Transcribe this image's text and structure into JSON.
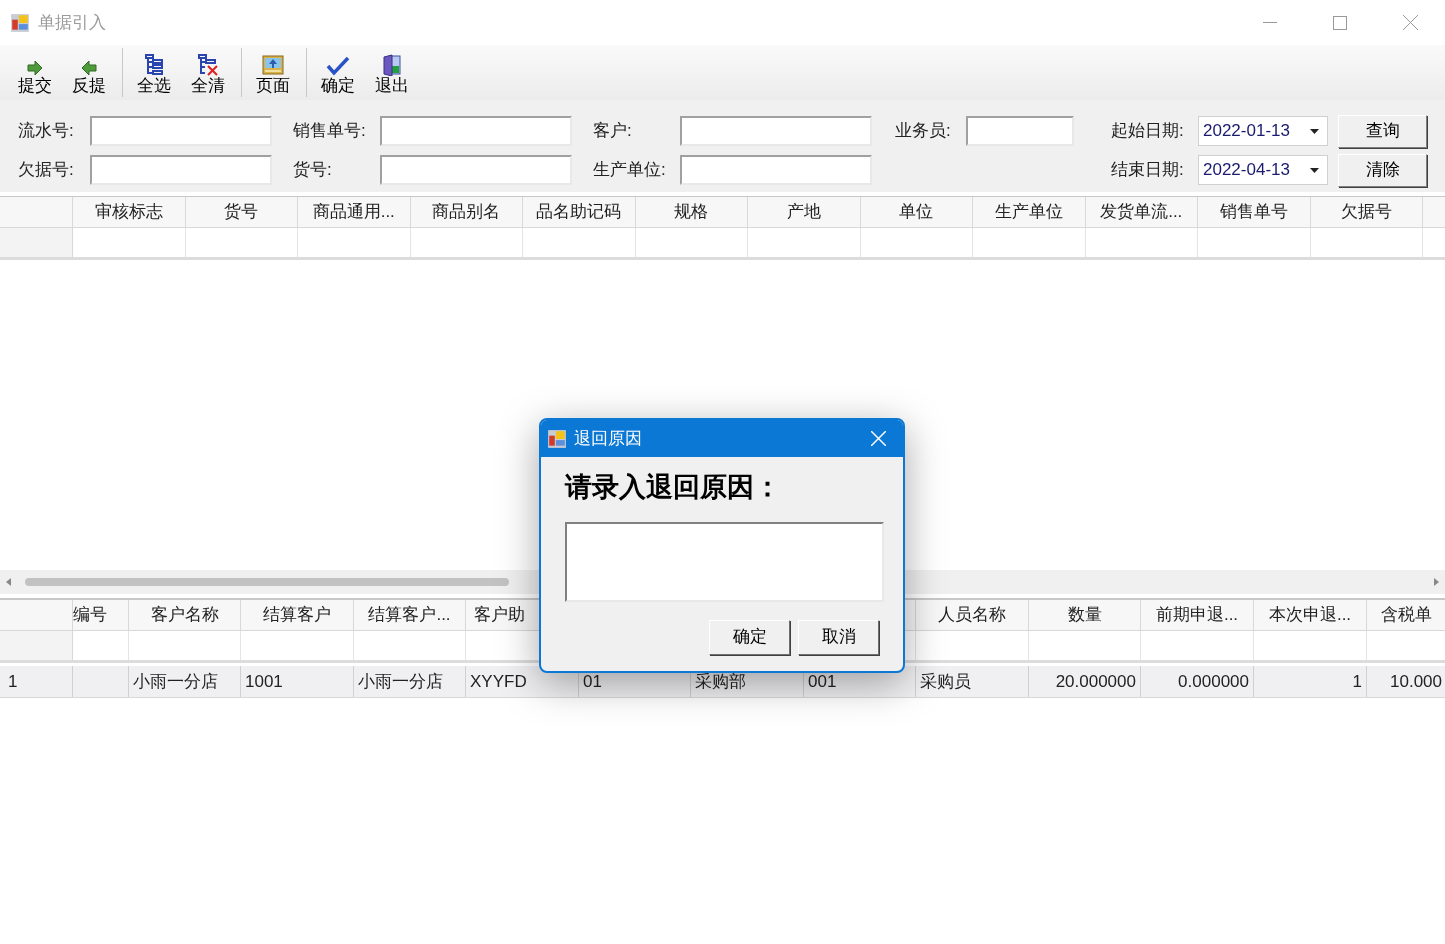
{
  "window": {
    "title": "单据引入"
  },
  "toolbar": [
    [
      {
        "label": "提交"
      },
      {
        "label": "反提"
      }
    ],
    [
      {
        "label": "全选"
      },
      {
        "label": "全清"
      }
    ],
    [
      {
        "label": "页面"
      }
    ],
    [
      {
        "label": "确定"
      },
      {
        "label": "退出"
      }
    ]
  ],
  "filter_rows": [
    {
      "fields": [
        {
          "label": "流水号:"
        },
        {
          "label": "销售单号:"
        },
        {
          "label": "客户:"
        },
        {
          "label": "业务员:"
        }
      ],
      "date": {
        "label": "起始日期:",
        "value": "2022-01-13"
      },
      "button": "查询"
    },
    {
      "fields": [
        {
          "label": "欠据号:"
        },
        {
          "label": "货号:"
        },
        {
          "label": "生产单位:"
        }
      ],
      "date": {
        "label": "结束日期:",
        "value": "2022-04-13"
      },
      "button": "清除"
    }
  ],
  "upper_grid": {
    "columns": [
      "审核标志",
      "货号",
      "商品通用...",
      "商品别名",
      "品名助记码",
      "规格",
      "产地",
      "单位",
      "生产单位",
      "发货单流...",
      "销售单号",
      "欠据号"
    ]
  },
  "lower_grid": {
    "columns": [
      {
        "label": "编号"
      },
      {
        "label": "客户名称"
      },
      {
        "label": "结算客户"
      },
      {
        "label": "结算客户..."
      },
      {
        "label": "客户助"
      },
      {},
      {},
      {},
      {
        "label": "人员名称"
      },
      {
        "label": "数量"
      },
      {
        "label": "前期申退..."
      },
      {
        "label": "本次申退..."
      },
      {
        "label": "含税单"
      }
    ],
    "rows": [
      {
        "header": "1",
        "cells": [
          "",
          "小雨一分店",
          "1001",
          "小雨一分店",
          "XYYFD",
          "01",
          "采购部",
          "001",
          "采购员",
          "20.000000",
          "0.000000",
          "1",
          "10.000"
        ]
      }
    ]
  },
  "dialog": {
    "title": "退回原因",
    "prompt": "请录入退回原因：",
    "buttons": [
      "确定",
      "取消"
    ]
  }
}
